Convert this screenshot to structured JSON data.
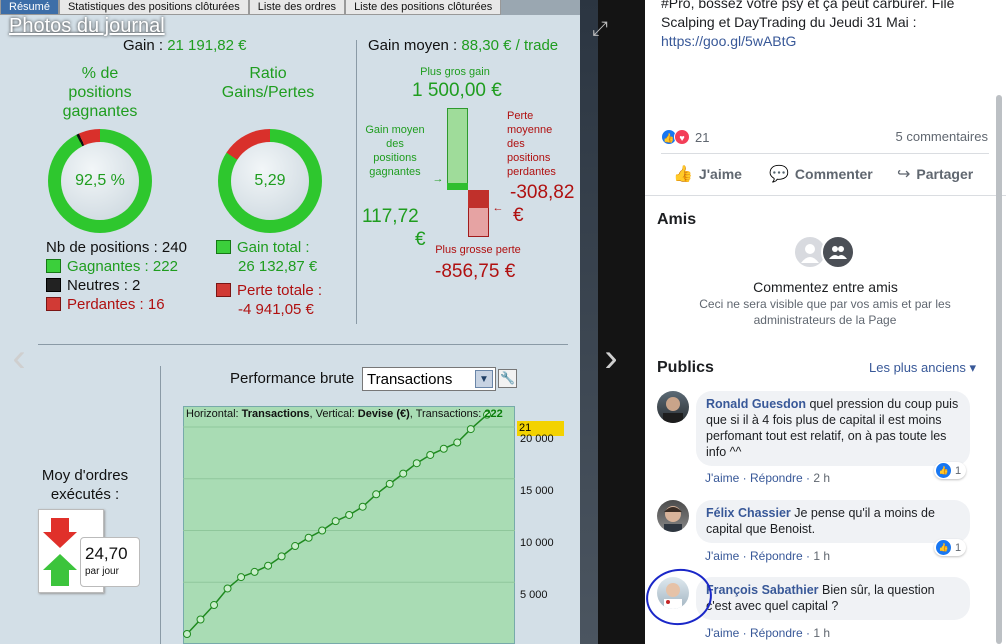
{
  "photo": {
    "tabs": [
      "Résumé",
      "Statistiques des positions clôturées",
      "Liste des ordres",
      "Liste des positions clôturées"
    ],
    "album_link": "Photos du journal",
    "summary": {
      "gain_label": "Gain : ",
      "gain_value": "21 191,82 €",
      "gain_moyen_label": "Gain moyen : ",
      "gain_moyen_value": "88,30 € / trade"
    },
    "pct_gagnantes": {
      "title_l1": "% de",
      "title_l2": "positions",
      "title_l3": "gagnantes",
      "value": "92,5 %",
      "ratio": 0.925
    },
    "ratio": {
      "title_l1": "Ratio",
      "title_l2": "Gains/Pertes",
      "value": "5,29",
      "ratio": 0.841
    },
    "positions": {
      "nb_label": "Nb de positions : 240",
      "gagnantes": "Gagnantes : 222",
      "neutres": "Neutres : 2",
      "perdantes": "Perdantes : 16"
    },
    "totals": {
      "gain_total_label": "Gain total :",
      "gain_total_value": "26 132,87 €",
      "perte_totale_label": "Perte totale :",
      "perte_totale_value": "-4 941,05 €"
    },
    "gains_pertes": {
      "plus_gros_gain_label": "Plus gros gain",
      "plus_gros_gain_value": "1 500,00 €",
      "gain_moyen_l1": "Gain moyen",
      "gain_moyen_l2": "des",
      "gain_moyen_l3": "positions",
      "gain_moyen_l4": "gagnantes",
      "gain_moyen_value": "117,72",
      "gain_moyen_unit": "€",
      "perte_moyenne_l1": "Perte",
      "perte_moyenne_l2": "moyenne",
      "perte_moyenne_l3": "des",
      "perte_moyenne_l4": "positions",
      "perte_moyenne_l5": "perdantes",
      "perte_moyenne_value": "-308,82",
      "perte_moyenne_unit": "€",
      "plus_grosse_perte_label": "Plus grosse perte",
      "plus_grosse_perte_value": "-856,75 €"
    },
    "performance": {
      "title": "Performance brute",
      "select_value": "Transactions",
      "chart_header_prefix": "Horizontal: ",
      "chart_header_h": "Transactions",
      "chart_header_mid": ", Vertical: ",
      "chart_header_v": "Devise (€)",
      "chart_header_suffix": ", Transactions: ",
      "chart_header_n": "222",
      "last_value": "21 191,82",
      "y_ticks": [
        "20 000",
        "15 000",
        "10 000",
        "5 000"
      ]
    },
    "moy_ordres": {
      "title_l1": "Moy d'ordres",
      "title_l2": "exécutés :",
      "value": "24,70",
      "unit": "par jour"
    }
  },
  "chart_data": {
    "type": "line",
    "xlabel": "Transactions",
    "ylabel": "Devise (€)",
    "ylim": [
      0,
      21191.82
    ],
    "x": [
      0,
      10,
      20,
      30,
      40,
      50,
      60,
      70,
      80,
      90,
      100,
      110,
      120,
      130,
      140,
      150,
      160,
      170,
      180,
      190,
      200,
      210,
      222
    ],
    "values": [
      0,
      1400,
      2800,
      4400,
      5500,
      6000,
      6600,
      7500,
      8500,
      9300,
      10000,
      10900,
      11500,
      12300,
      13500,
      14500,
      15500,
      16500,
      17300,
      17900,
      18500,
      19800,
      21191.82
    ]
  },
  "panel": {
    "post_line1": "#Pro, bossez votre psy et ça peut carburer. File",
    "post_line2": "Scalping et DayTrading du Jeudi 31 Mai :",
    "post_link": "https://goo.gl/5wABtG",
    "reactions_count": "21",
    "comments_count": "5 commentaires",
    "actions": {
      "like": "J'aime",
      "comment": "Commenter",
      "share": "Partager"
    },
    "friends_title": "Amis",
    "friends_main": "Commentez entre amis",
    "friends_sub": "Ceci ne sera visible que par vos amis et par les administrateurs de la Page",
    "publics_title": "Publics",
    "sort_label": "Les plus anciens",
    "reply_label": "Répondre",
    "like_label": "J'aime",
    "comments": [
      {
        "name": "Ronald Guesdon",
        "text": "quel pression du coup puis que si il à 4 fois plus de capital il est moins perfomant tout est relatif, on à pas toute les info ^^",
        "time": "2 h",
        "likes": "1"
      },
      {
        "name": "Félix Chassier",
        "text": "Je pense qu'il a moins de capital que Benoist.",
        "time": "1 h",
        "likes": "1"
      },
      {
        "name": "François Sabathier",
        "text": "Bien sûr, la question c'est avec quel capital ?",
        "time": "1 h",
        "likes": ""
      }
    ]
  },
  "colors": {
    "green": "#1f9d1f",
    "red": "#b01010",
    "facebook_blue": "#385898",
    "annotation_circle": "#1a27c8"
  }
}
